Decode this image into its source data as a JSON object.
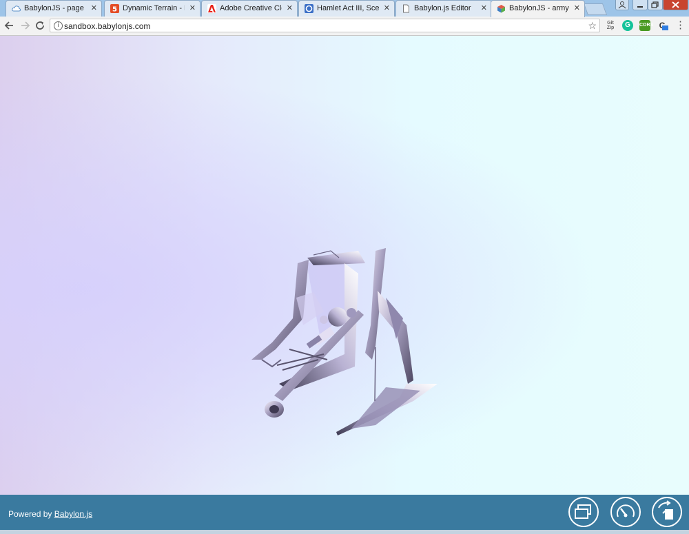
{
  "browser": {
    "tabs": [
      {
        "title": "BabylonJS - page - JSF",
        "favicon": "cloud-icon",
        "active": false
      },
      {
        "title": "Dynamic Terrain - Pag",
        "favicon": "html5-icon",
        "active": false
      },
      {
        "title": "Adobe Creative Cloud",
        "favicon": "adobe-icon",
        "active": false
      },
      {
        "title": "Hamlet Act III, Scene",
        "favicon": "book-icon",
        "active": false
      },
      {
        "title": "Babylon.js Editor",
        "favicon": "page-icon",
        "active": false
      },
      {
        "title": "BabylonJS - armyunit",
        "favicon": "cube-icon",
        "active": true
      }
    ],
    "url": "sandbox.babylonjs.com",
    "extensions": {
      "gitzip": "Git Zip",
      "grammarly": "G",
      "cors": "CORS",
      "translate": "C"
    }
  },
  "viewer": {
    "powered_by_prefix": "Powered by",
    "powered_by_link": "Babylon.js"
  },
  "colors": {
    "footer": "#3a7a9f",
    "tabstrip": "#9dc4e8",
    "close_button": "#c8442f"
  }
}
